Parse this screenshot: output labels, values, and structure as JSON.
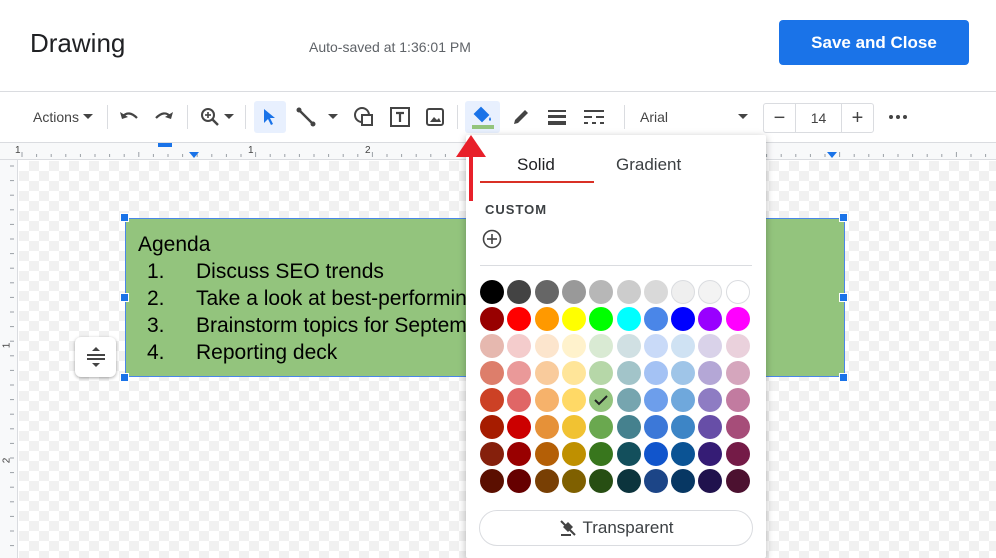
{
  "header": {
    "title": "Drawing",
    "autosave": "Auto-saved at 1:36:01 PM",
    "save_label": "Save and Close"
  },
  "toolbar": {
    "actions_label": "Actions",
    "font_name": "Arial",
    "font_size": "14",
    "minus": "−",
    "plus": "+"
  },
  "ruler": {
    "top_numbers": [
      "1",
      "1",
      "2"
    ],
    "left_numbers": [
      "1",
      "2"
    ]
  },
  "shape": {
    "fill_color": "#93c47d",
    "heading": "Agenda",
    "items": [
      {
        "num": "1.",
        "text": "Discuss SEO trends"
      },
      {
        "num": "2.",
        "text": "Take a look at best-performing"
      },
      {
        "num": "3.",
        "text": "Brainstorm topics for September"
      },
      {
        "num": "4.",
        "text": "Reporting deck"
      }
    ]
  },
  "popup": {
    "tab_solid": "Solid",
    "tab_gradient": "Gradient",
    "custom_label": "CUSTOM",
    "transparent_label": "Transparent",
    "selected": "#93c47d",
    "palette": [
      [
        "#000000",
        "#434343",
        "#666666",
        "#999999",
        "#b7b7b7",
        "#cccccc",
        "#d9d9d9",
        "#efefef",
        "#f3f3f3",
        "#ffffff"
      ],
      [
        "#980000",
        "#ff0000",
        "#ff9900",
        "#ffff00",
        "#00ff00",
        "#00ffff",
        "#4a86e8",
        "#0000ff",
        "#9900ff",
        "#ff00ff"
      ],
      [
        "#e6b8af",
        "#f4cccc",
        "#fce5cd",
        "#fff2cc",
        "#d9ead3",
        "#d0e0e3",
        "#c9daf8",
        "#cfe2f3",
        "#d9d2e9",
        "#ead1dc"
      ],
      [
        "#dd7e6b",
        "#ea9999",
        "#f9cb9c",
        "#ffe599",
        "#b6d7a8",
        "#a2c4c9",
        "#a4c2f4",
        "#9fc5e8",
        "#b4a7d6",
        "#d5a6bd"
      ],
      [
        "#cc4125",
        "#e06666",
        "#f6b26b",
        "#ffd966",
        "#93c47d",
        "#76a5af",
        "#6d9eeb",
        "#6fa8dc",
        "#8e7cc3",
        "#c27ba0"
      ],
      [
        "#a61c00",
        "#cc0000",
        "#e69138",
        "#f1c232",
        "#6aa84f",
        "#45818e",
        "#3c78d8",
        "#3d85c6",
        "#674ea7",
        "#a64d79"
      ],
      [
        "#85200c",
        "#990000",
        "#b45f06",
        "#bf9000",
        "#38761d",
        "#134f5c",
        "#1155cc",
        "#0b5394",
        "#351c75",
        "#741b47"
      ],
      [
        "#5b0f00",
        "#660000",
        "#783f04",
        "#7f6000",
        "#274e13",
        "#0c343d",
        "#1c4587",
        "#073763",
        "#20124d",
        "#4c1130"
      ]
    ]
  }
}
